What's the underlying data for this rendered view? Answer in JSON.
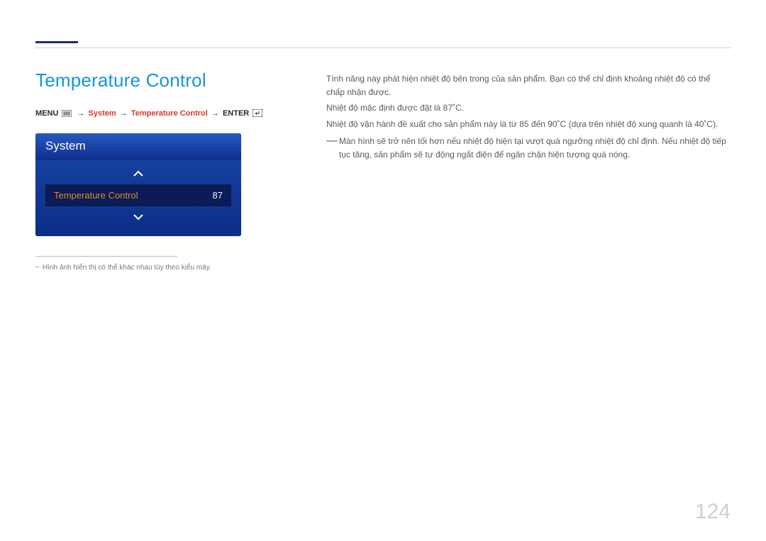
{
  "page": {
    "title": "Temperature Control",
    "number": "124"
  },
  "breadcrumb": {
    "menu": "MENU",
    "system": "System",
    "temperature_control": "Temperature Control",
    "enter": "ENTER",
    "arrow": "→"
  },
  "osd": {
    "panel_title": "System",
    "item_label": "Temperature Control",
    "item_value": "87"
  },
  "footnote": "Hình ảnh hiển thị có thể khác nhau tùy theo kiểu máy.",
  "body": {
    "p1": "Tính năng này phát hiện nhiệt độ bên trong của sản phẩm. Bạn có thể chỉ định khoảng nhiệt độ có thể chấp nhận được.",
    "p2": "Nhiệt độ mặc định được đặt là 87˚C.",
    "p3": "Nhiệt độ vận hành đề xuất cho sản phẩm này là từ 85 đến 90˚C (dựa trên nhiệt độ xung quanh là 40˚C).",
    "note": "Màn hình sẽ trở nên tối hơn nếu nhiệt độ hiện tại vượt quá ngưỡng nhiệt độ chỉ định. Nếu nhiệt độ tiếp tục tăng, sản phẩm sẽ tự động ngắt điện để ngăn chặn hiện tượng quá nóng."
  }
}
